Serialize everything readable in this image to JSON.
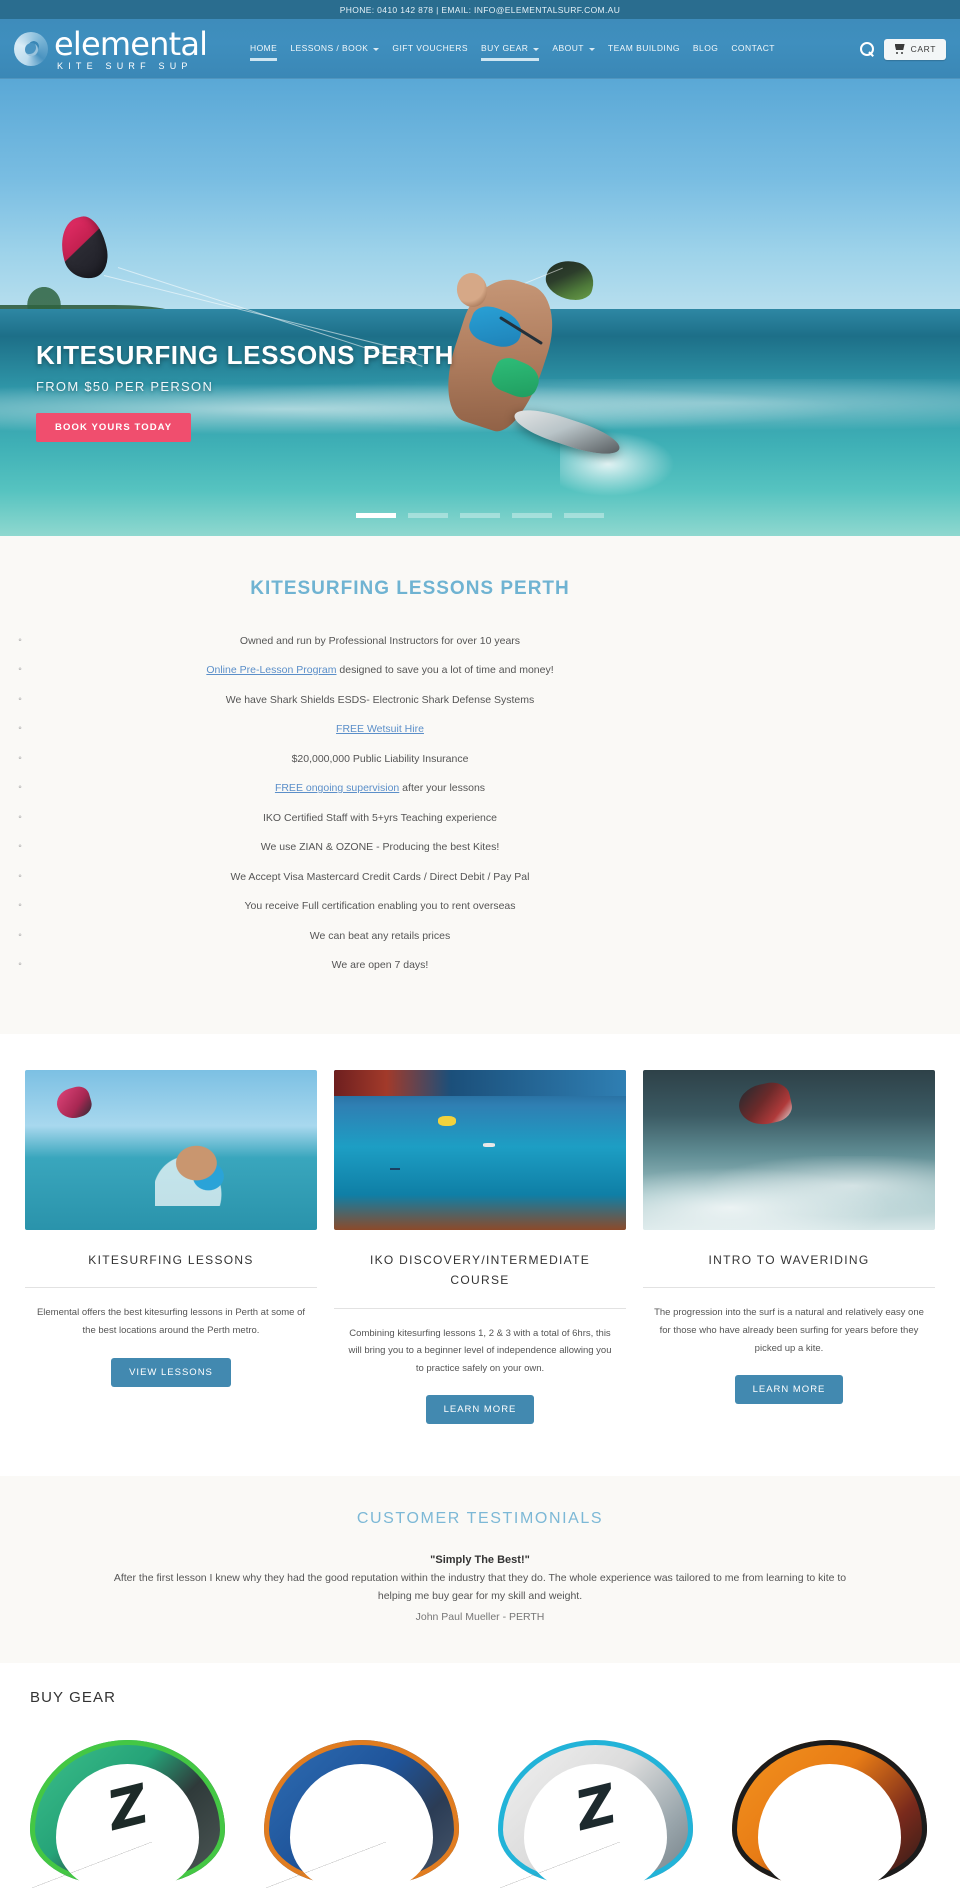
{
  "topbar": {
    "contact": "PHONE: 0410 142 878 | EMAIL: INFO@ELEMENTALSURF.COM.AU"
  },
  "header": {
    "logo_main": "elemental",
    "logo_sub": "KITE SURF SUP",
    "nav": [
      {
        "label": "HOME",
        "has_caret": false,
        "active": true
      },
      {
        "label": "LESSONS / BOOK",
        "has_caret": true,
        "active": false
      },
      {
        "label": "GIFT VOUCHERS",
        "has_caret": false,
        "active": false
      },
      {
        "label": "BUY GEAR",
        "has_caret": true,
        "active": true
      },
      {
        "label": "ABOUT",
        "has_caret": true,
        "active": false
      },
      {
        "label": "TEAM BUILDING",
        "has_caret": false,
        "active": false
      },
      {
        "label": "BLOG",
        "has_caret": false,
        "active": false
      },
      {
        "label": "CONTACT",
        "has_caret": false,
        "active": false
      }
    ],
    "search_icon": "search-icon",
    "cart_label": "CART",
    "cart_icon": "shopping-cart-icon"
  },
  "hero": {
    "title": "KITESURFING LESSONS PERTH",
    "subtitle": "FROM $50 PER PERSON",
    "cta": "BOOK YOURS TODAY",
    "cta_color": "#f04e6e",
    "slides": 5,
    "active_slide": 1
  },
  "features": {
    "title": "KITESURFING LESSONS PERTH",
    "title_color": "#6fb3d2",
    "items": [
      {
        "text": "Owned and run by Professional Instructors for over 10 years",
        "link": ""
      },
      {
        "text": " designed to save you a lot of time and money!",
        "link": "Online Pre-Lesson Program"
      },
      {
        "text": "We have Shark Shields ESDS- Electronic Shark Defense Systems",
        "link": ""
      },
      {
        "text": "",
        "link": "FREE Wetsuit Hire"
      },
      {
        "text": "$20,000,000 Public Liability Insurance",
        "link": ""
      },
      {
        "text": " after your lessons",
        "link": "FREE ongoing supervision"
      },
      {
        "text": "IKO Certified Staff with 5+yrs Teaching experience",
        "link": ""
      },
      {
        "text": "We use ZIAN & OZONE - Producing the best Kites!",
        "link": ""
      },
      {
        "text": "We Accept Visa Mastercard Credit Cards / Direct Debit / Pay Pal",
        "link": ""
      },
      {
        "text": "You receive Full certification enabling you to rent overseas",
        "link": ""
      },
      {
        "text": "We can beat any retails prices",
        "link": ""
      },
      {
        "text": "We are open 7 days!",
        "link": ""
      }
    ]
  },
  "cards": [
    {
      "title": "KITESURFING LESSONS",
      "body": "Elemental offers the best kitesurfing lessons in Perth at some of the best locations around the Perth metro.",
      "button": "VIEW LESSONS",
      "image": "kitesurfer-riding-photo"
    },
    {
      "title": "IKO DISCOVERY/INTERMEDIATE COURSE",
      "body": "Combining kitesurfing lessons 1, 2 & 3 with a total of 6hrs, this will bring you to a beginner level of independence allowing you to practice safely on your own.",
      "button": "LEARN MORE",
      "image": "aerial-water-kites-photo"
    },
    {
      "title": "INTRO TO WAVERIDING",
      "body": "The progression into the surf is a natural and relatively easy one for those who have already been surfing for years before they picked up a kite.",
      "button": "LEARN MORE",
      "image": "wave-riding-photo"
    }
  ],
  "testimonials": {
    "title": "CUSTOMER TESTIMONIALS",
    "quote": "\"Simply The Best!\"",
    "body": "After the first lesson I knew why they had the good reputation within the industry that they do. The whole experience was tailored to me from learning to kite to helping me buy gear for my skill and weight.",
    "author": "John Paul Mueller - PERTH"
  },
  "gear": {
    "title": "BUY GEAR",
    "items": [
      {
        "name": "zian-aquila-green-kite",
        "label": ""
      },
      {
        "name": "zian-hantu-blue-kite",
        "label": ""
      },
      {
        "name": "zian-white-blue-kite",
        "label": ""
      },
      {
        "name": "reo-orange-kite",
        "label": ""
      }
    ]
  }
}
